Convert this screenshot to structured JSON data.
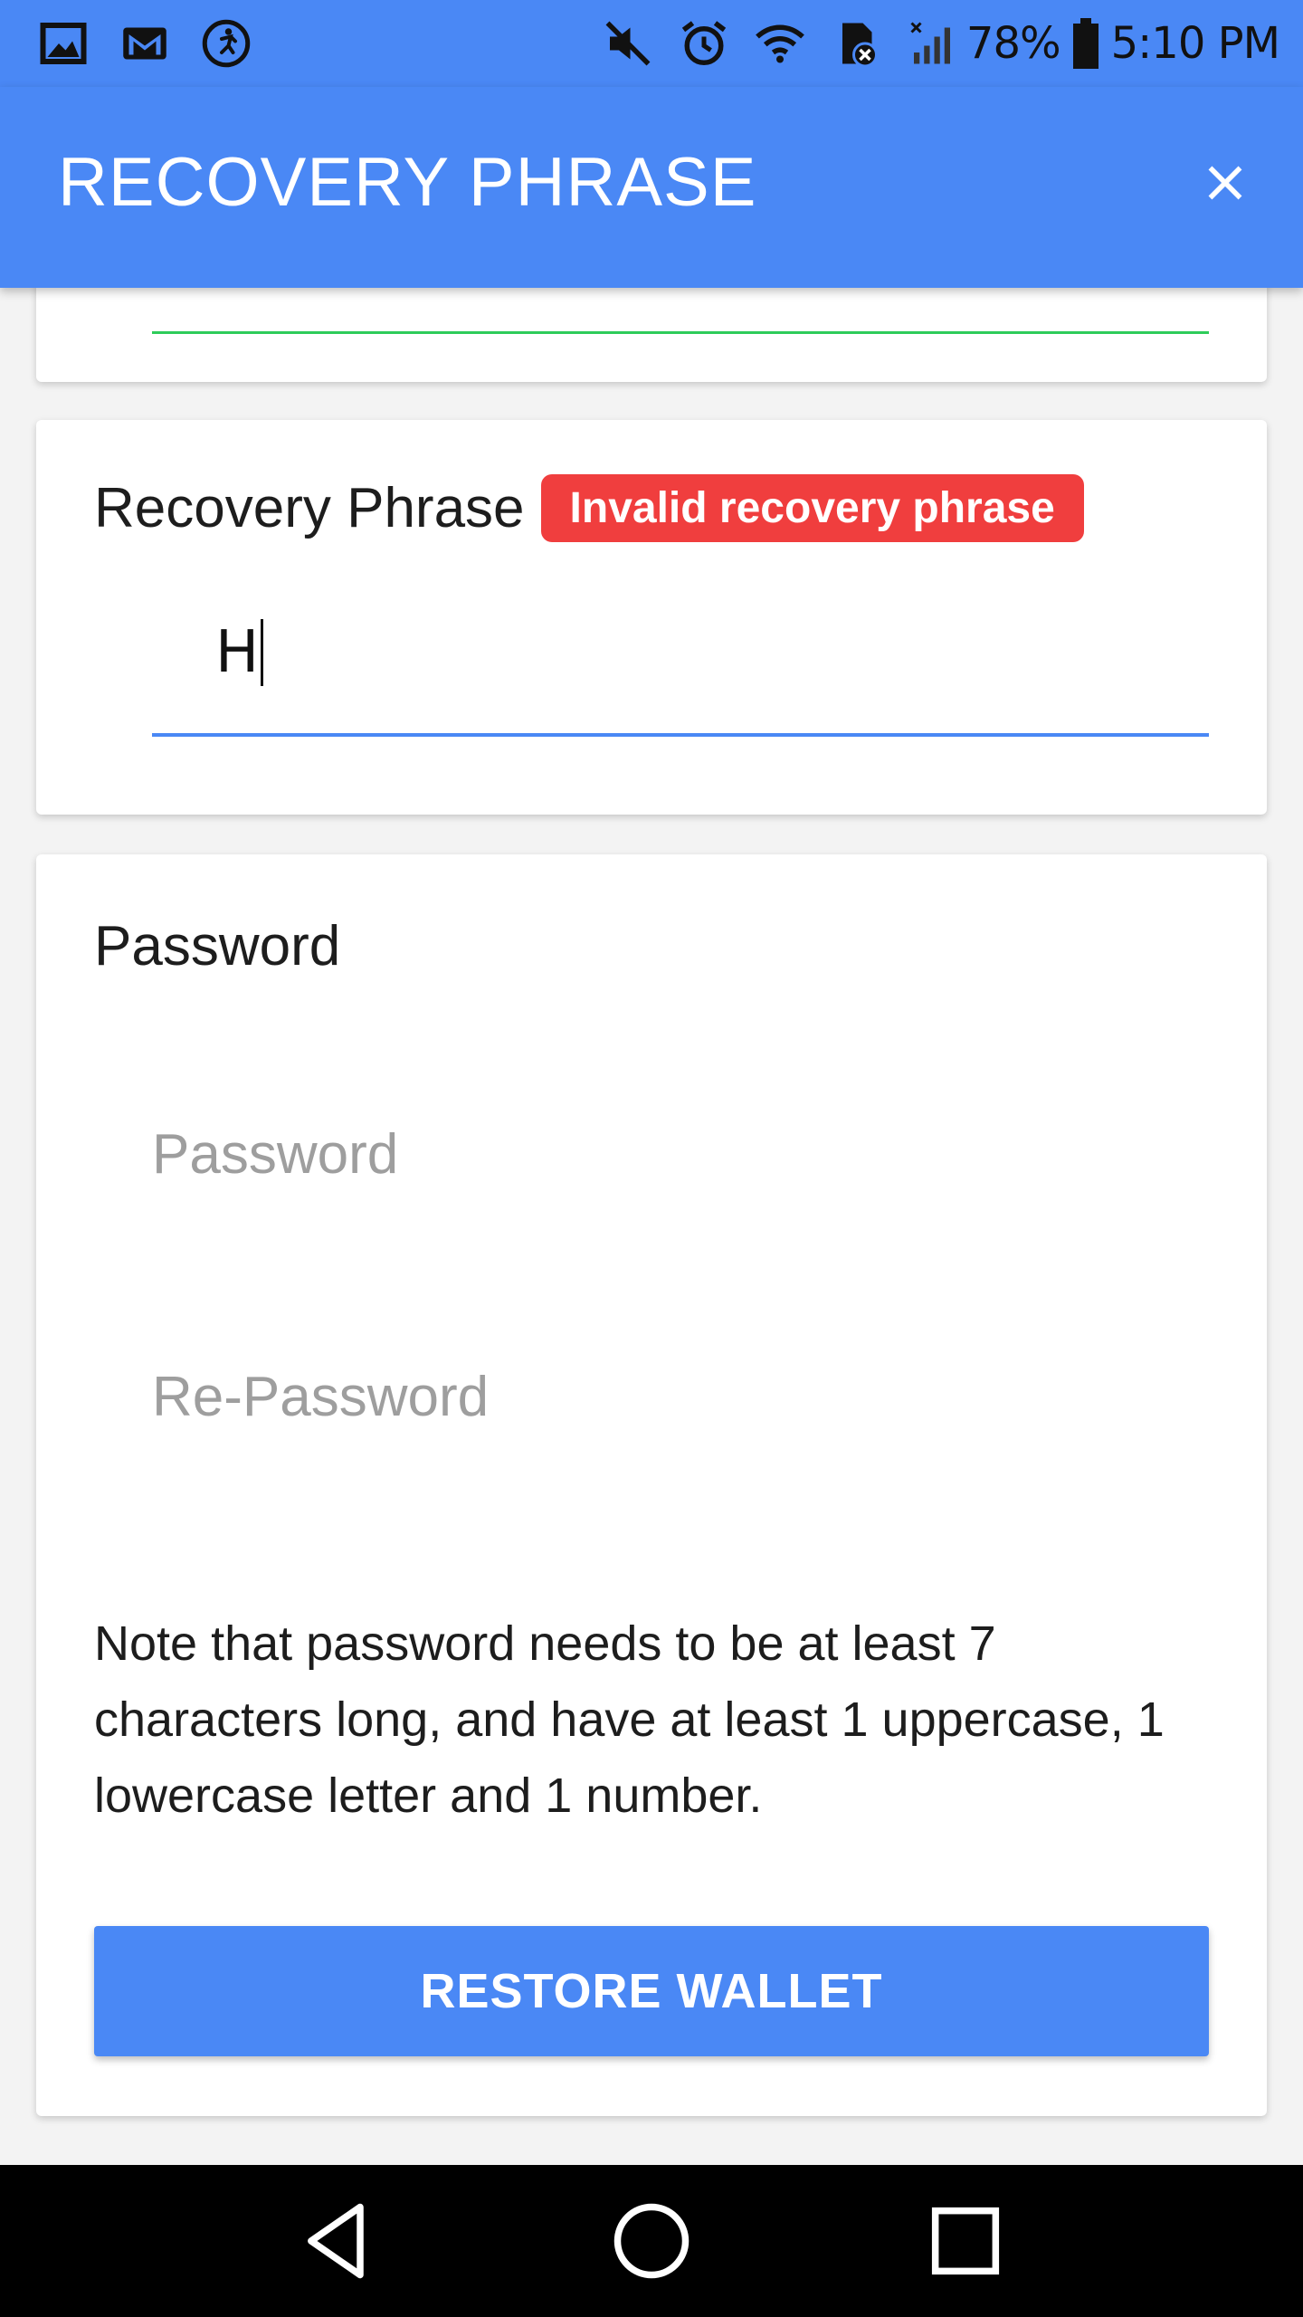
{
  "status_bar": {
    "battery_percent": "78%",
    "time": "5:10 PM",
    "icons_left": [
      "gallery-icon",
      "gmail-icon",
      "fitness-icon"
    ],
    "icons_right": [
      "mute-icon",
      "alarm-icon",
      "wifi-icon",
      "sd-card-icon",
      "signal-icon",
      "battery-icon"
    ]
  },
  "app_bar": {
    "title": "RECOVERY PHRASE",
    "close_icon": "close-icon"
  },
  "recovery_phrase": {
    "label": "Recovery Phrase",
    "error_badge": "Invalid recovery phrase",
    "input_value": "H"
  },
  "password_section": {
    "title": "Password",
    "password_placeholder": "Password",
    "repassword_placeholder": "Re-Password",
    "note": "Note that password needs to be at least 7 characters long, and have at least 1 uppercase, 1 lowercase letter and 1 number.",
    "restore_button": "RESTORE WALLET"
  },
  "nav_bar": {
    "icons": [
      "back-icon",
      "home-icon",
      "recents-icon"
    ]
  },
  "colors": {
    "primary": "#4a88f5",
    "error": "#f03e3e",
    "success_line": "#2ecc5a",
    "placeholder": "#9e9e9e"
  }
}
